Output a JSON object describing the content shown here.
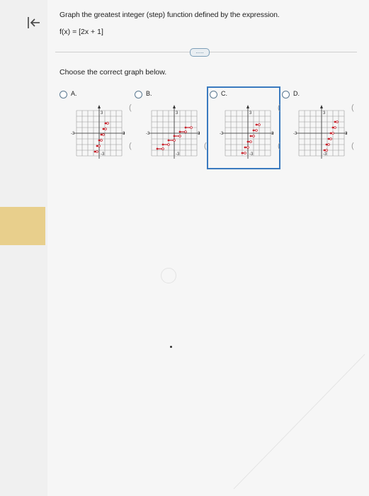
{
  "question": {
    "prompt": "Graph the greatest integer (step) function defined by the expression.",
    "expression": "f(x) = [2x + 1]",
    "instruction": "Choose the correct graph below.",
    "more_button": "....."
  },
  "options": [
    {
      "letter": "A.",
      "selected": false
    },
    {
      "letter": "B.",
      "selected": false
    },
    {
      "letter": "C.",
      "selected": true
    },
    {
      "letter": "D.",
      "selected": false
    }
  ],
  "graph_ticks": {
    "pos": "3",
    "neg": "-3"
  },
  "paren_char": "(",
  "colors": {
    "accent": "#3a7abf",
    "step_red": "#c8202a",
    "grid": "#9a9a9a",
    "highlight": "#e8cf8c"
  }
}
